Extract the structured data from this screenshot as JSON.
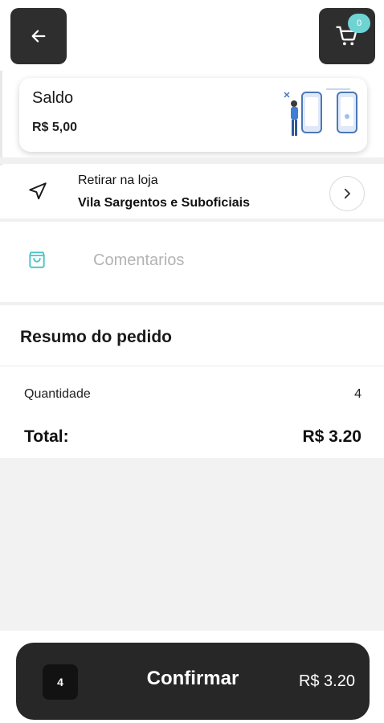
{
  "header": {
    "cart_count": "0",
    "icons": [
      "arrow-left-icon",
      "cart-icon"
    ]
  },
  "balance": {
    "title": "Saldo",
    "value": "R$ 5,00"
  },
  "pickup": {
    "label": "Retirar na loja",
    "store": "Vila Sargentos e Suboficiais"
  },
  "comments": {
    "placeholder": "Comentarios",
    "value": ""
  },
  "summary": {
    "title": "Resumo do pedido",
    "quantity_label": "Quantidade",
    "quantity_value": "4",
    "total_label": "Total:",
    "total_value": "R$ 3.20"
  },
  "confirm": {
    "quantity": "4",
    "label": "Confirmar",
    "price": "R$ 3.20"
  },
  "colors": {
    "dark": "#2e2e2e",
    "accent": "#4fc3c7",
    "badge": "#6fd3d4"
  }
}
